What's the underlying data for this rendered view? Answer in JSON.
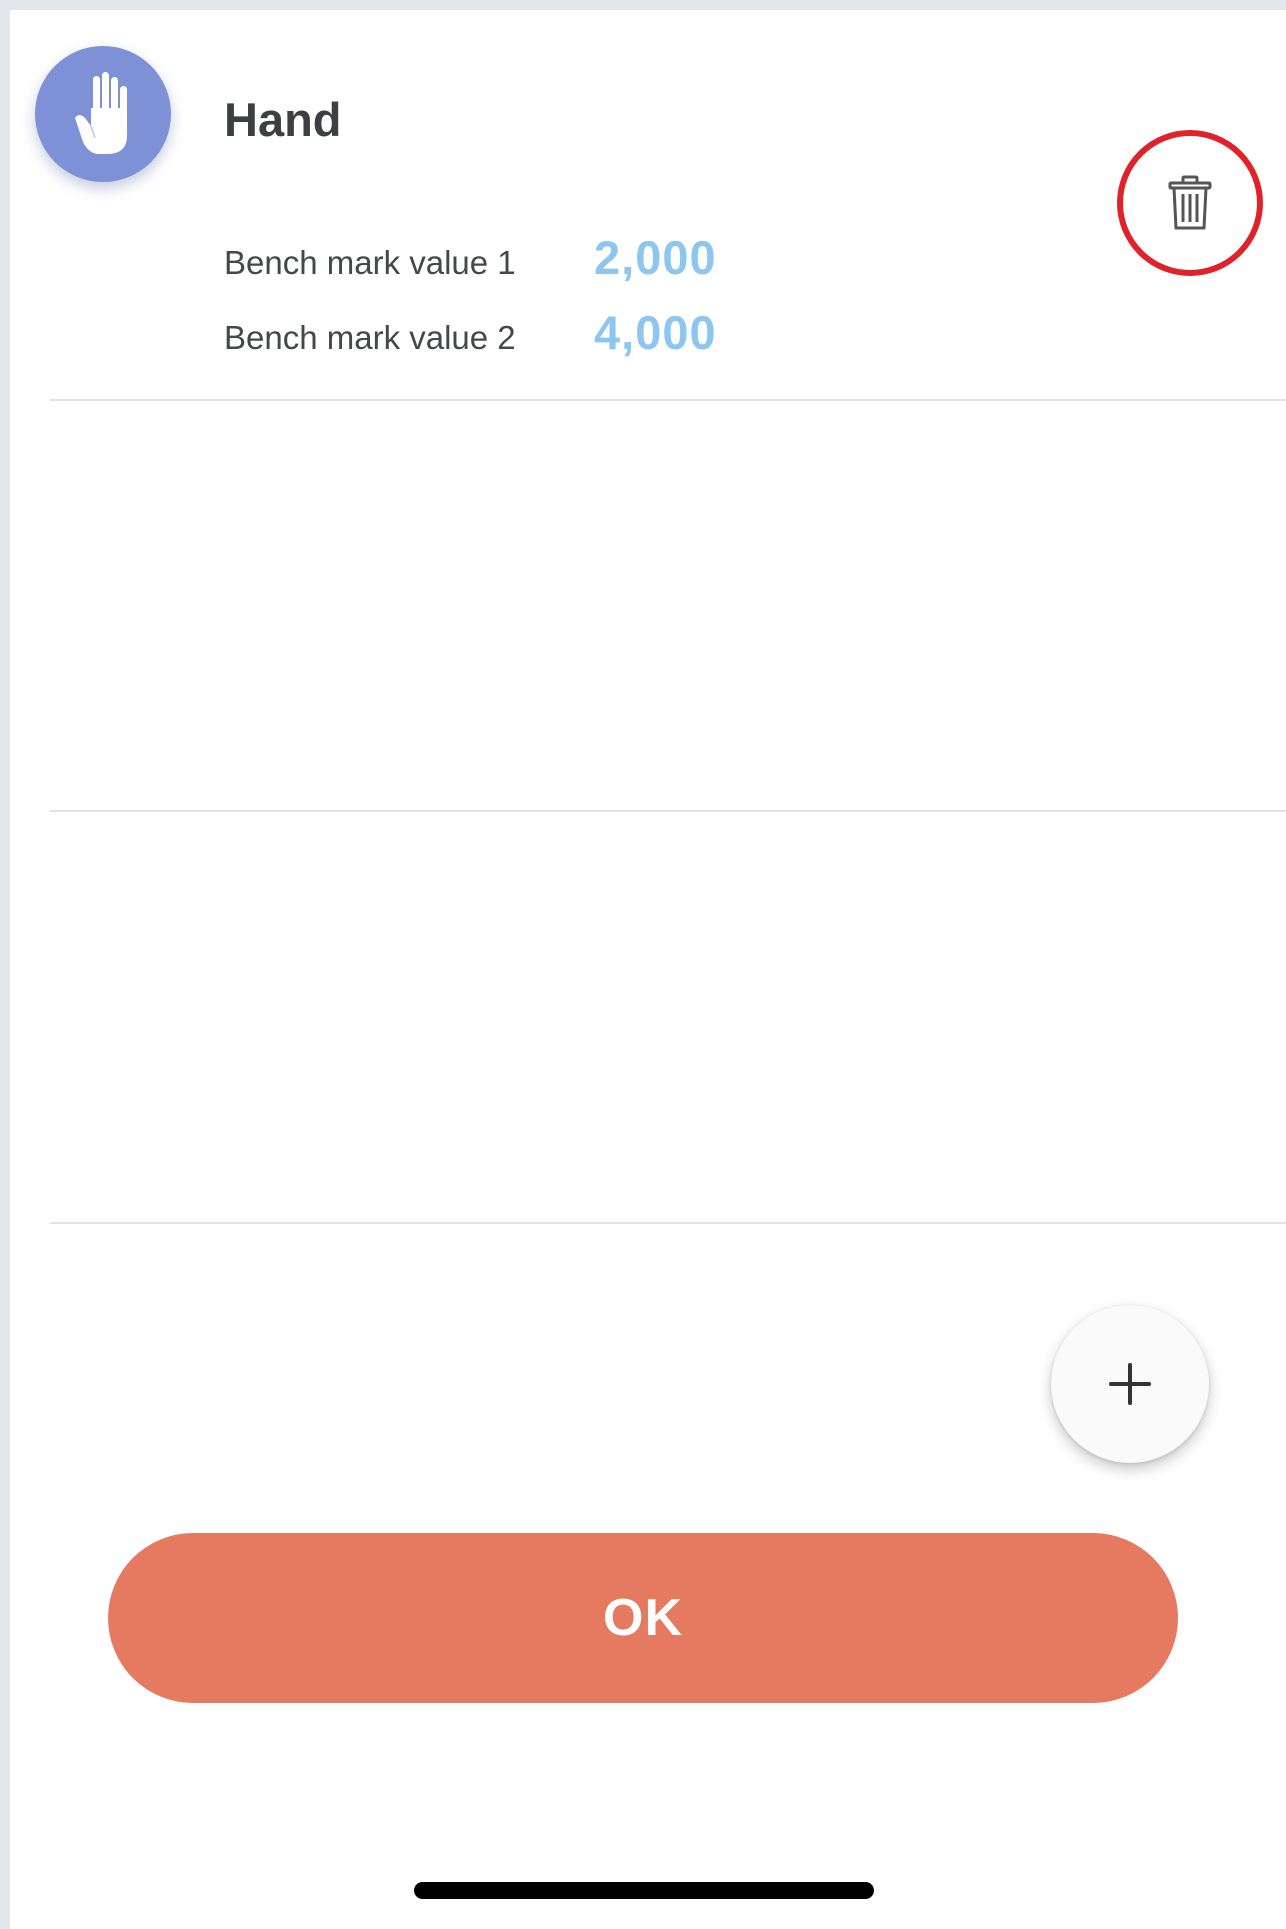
{
  "item": {
    "icon": "hand-icon",
    "title": "Hand",
    "benchmarks": [
      {
        "label": "Bench mark value 1",
        "value": "2,000"
      },
      {
        "label": "Bench mark value 2",
        "value": "4,000"
      }
    ]
  },
  "actions": {
    "delete_icon": "trash-icon",
    "add_icon": "plus-icon",
    "ok_label": "OK"
  },
  "colors": {
    "avatar": "#7e91d6",
    "value": "#8dc7f0",
    "ok_button": "#e57a61",
    "highlight_ring": "#e0232b"
  }
}
